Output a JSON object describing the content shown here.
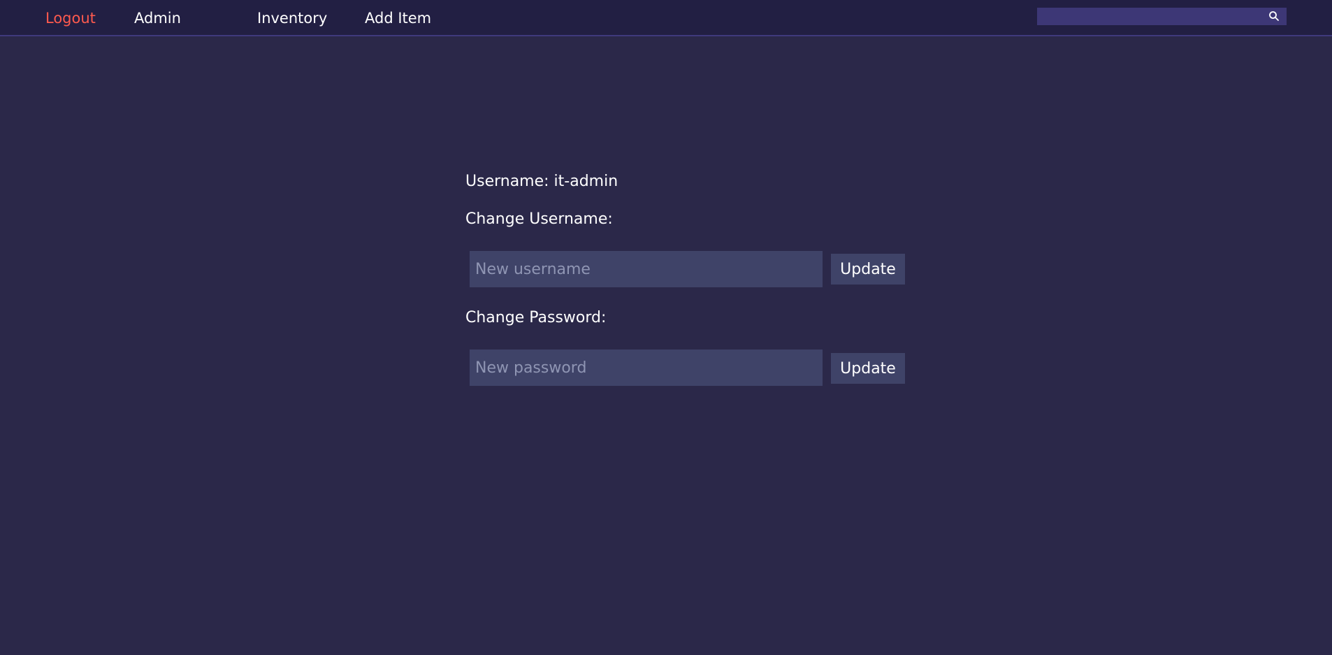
{
  "nav": {
    "logout": "Logout",
    "admin": "Admin",
    "inventory": "Inventory",
    "add_item": "Add Item"
  },
  "search": {
    "placeholder": "",
    "icon": "search-icon"
  },
  "account": {
    "username_label": "Username: it-admin",
    "change_username_label": "Change Username:",
    "username_placeholder": "New username",
    "username_button": "Update",
    "change_password_label": "Change Password:",
    "password_placeholder": "New password",
    "password_button": "Update"
  },
  "colors": {
    "background": "#2b2849",
    "navbar": "#221f43",
    "logout_accent": "#ff5a4e",
    "input_bg": "#3f4368",
    "search_bg": "#3d3776"
  }
}
